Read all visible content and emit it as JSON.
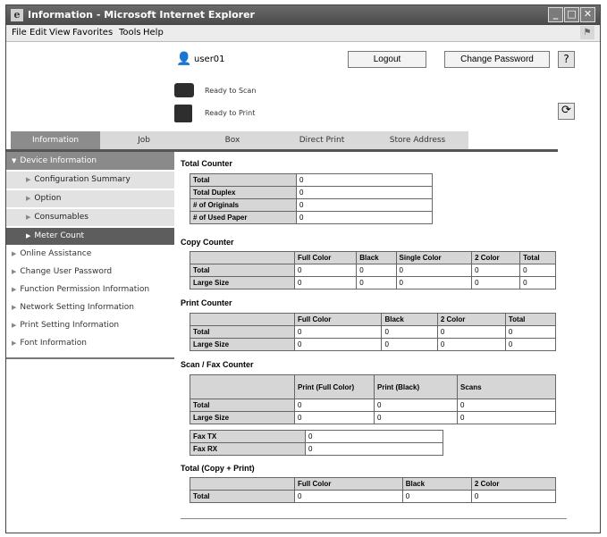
{
  "window": {
    "title": "Information - Microsoft Internet Explorer",
    "menu": [
      "File",
      "Edit",
      "View",
      "Favorites",
      "Tools",
      "Help"
    ]
  },
  "header": {
    "user": "user01",
    "logout": "Logout",
    "change_password": "Change Password",
    "help": "?",
    "status": [
      "Ready to Scan",
      "Ready to Print"
    ]
  },
  "tabs": [
    "Information",
    "Job",
    "Box",
    "Direct Print",
    "Store Address"
  ],
  "sidebar": {
    "head": "Device Information",
    "sub": [
      "Configuration Summary",
      "Option",
      "Consumables",
      "Meter Count"
    ],
    "items": [
      "Online Assistance",
      "Change User Password",
      "Function Permission Information",
      "Network Setting Information",
      "Print Setting Information",
      "Font Information"
    ]
  },
  "total_counter": {
    "title": "Total Counter",
    "rows": [
      {
        "label": "Total",
        "value": "0"
      },
      {
        "label": "Total Duplex",
        "value": "0"
      },
      {
        "label": "# of Originals",
        "value": "0"
      },
      {
        "label": "# of Used Paper",
        "value": "0"
      }
    ]
  },
  "copy_counter": {
    "title": "Copy Counter",
    "cols": [
      "Full Color",
      "Black",
      "Single Color",
      "2 Color",
      "Total"
    ],
    "rows": [
      {
        "label": "Total",
        "values": [
          "0",
          "0",
          "0",
          "0",
          "0"
        ]
      },
      {
        "label": "Large Size",
        "values": [
          "0",
          "0",
          "0",
          "0",
          "0"
        ]
      }
    ]
  },
  "print_counter": {
    "title": "Print Counter",
    "cols": [
      "Full Color",
      "Black",
      "2 Color",
      "Total"
    ],
    "rows": [
      {
        "label": "Total",
        "values": [
          "0",
          "0",
          "0",
          "0"
        ]
      },
      {
        "label": "Large Size",
        "values": [
          "0",
          "0",
          "0",
          "0"
        ]
      }
    ]
  },
  "scan_fax_counter": {
    "title": "Scan / Fax Counter",
    "cols": [
      "Print (Full Color)",
      "Print (Black)",
      "Scans"
    ],
    "rows": [
      {
        "label": "Total",
        "values": [
          "0",
          "0",
          "0"
        ]
      },
      {
        "label": "Large Size",
        "values": [
          "0",
          "0",
          "0"
        ]
      }
    ],
    "fax": [
      {
        "label": "Fax TX",
        "value": "0"
      },
      {
        "label": "Fax RX",
        "value": "0"
      }
    ]
  },
  "total_copy_print": {
    "title": "Total (Copy + Print)",
    "cols": [
      "Full Color",
      "Black",
      "2 Color"
    ],
    "rows": [
      {
        "label": "Total",
        "values": [
          "0",
          "0",
          "0"
        ]
      }
    ]
  }
}
